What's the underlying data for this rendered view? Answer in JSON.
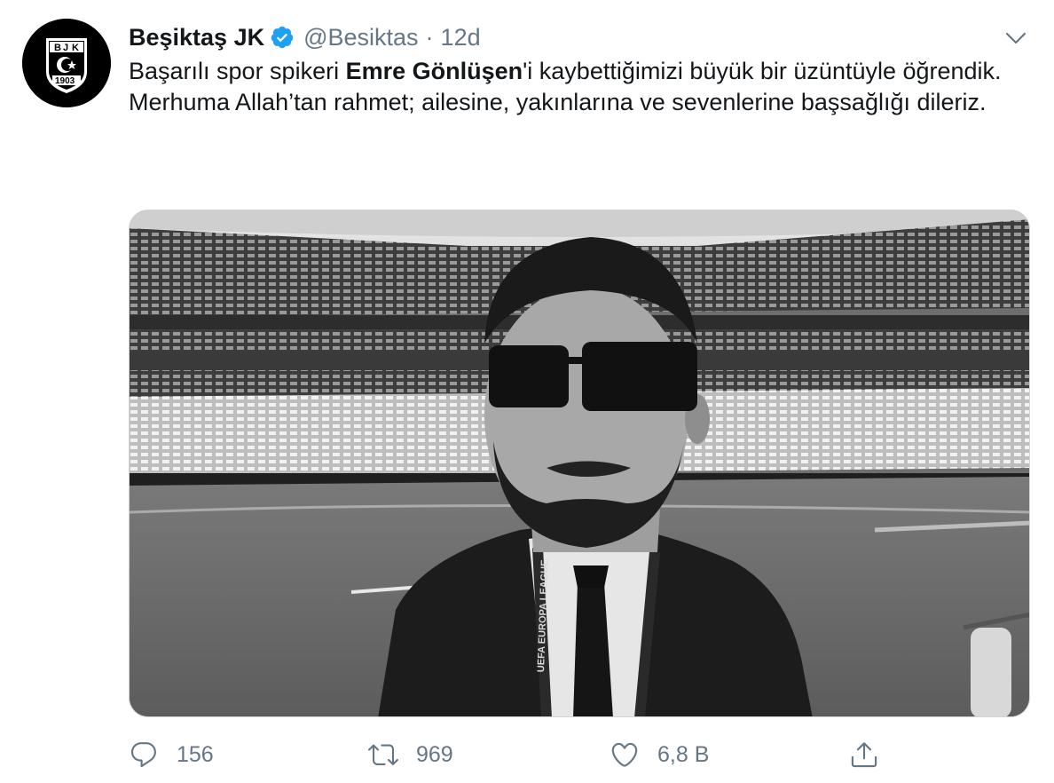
{
  "account": {
    "display_name": "Beşiktaş JK",
    "handle": "@Besiktas",
    "separator": "·",
    "time": "12d",
    "avatar_icon": "besiktas-crest-icon",
    "avatar_text_letters": [
      "B",
      "J",
      "K"
    ],
    "avatar_year": "1903"
  },
  "tweet": {
    "line1_pre": "Başarılı spor spikeri ",
    "line1_bold": "Emre Gönlüşen",
    "line1_post": "'i kaybettiğimizi büyük bir üzüntüyle öğrendik.",
    "line2": "Merhuma Allah’tan rahmet; ailesine, yakınlarına ve sevenlerine başsağlığı dileriz."
  },
  "media": {
    "lanyard_text": "UEFA EUROPA LEAGUE"
  },
  "actions": {
    "reply_count": "156",
    "retweet_count": "969",
    "like_count": "6,8 B",
    "reply_icon": "reply-icon",
    "retweet_icon": "retweet-icon",
    "like_icon": "heart-icon",
    "share_icon": "share-icon"
  },
  "colors": {
    "verified": "#1da1f2",
    "secondary_text": "#657786",
    "primary_text": "#14171a"
  }
}
